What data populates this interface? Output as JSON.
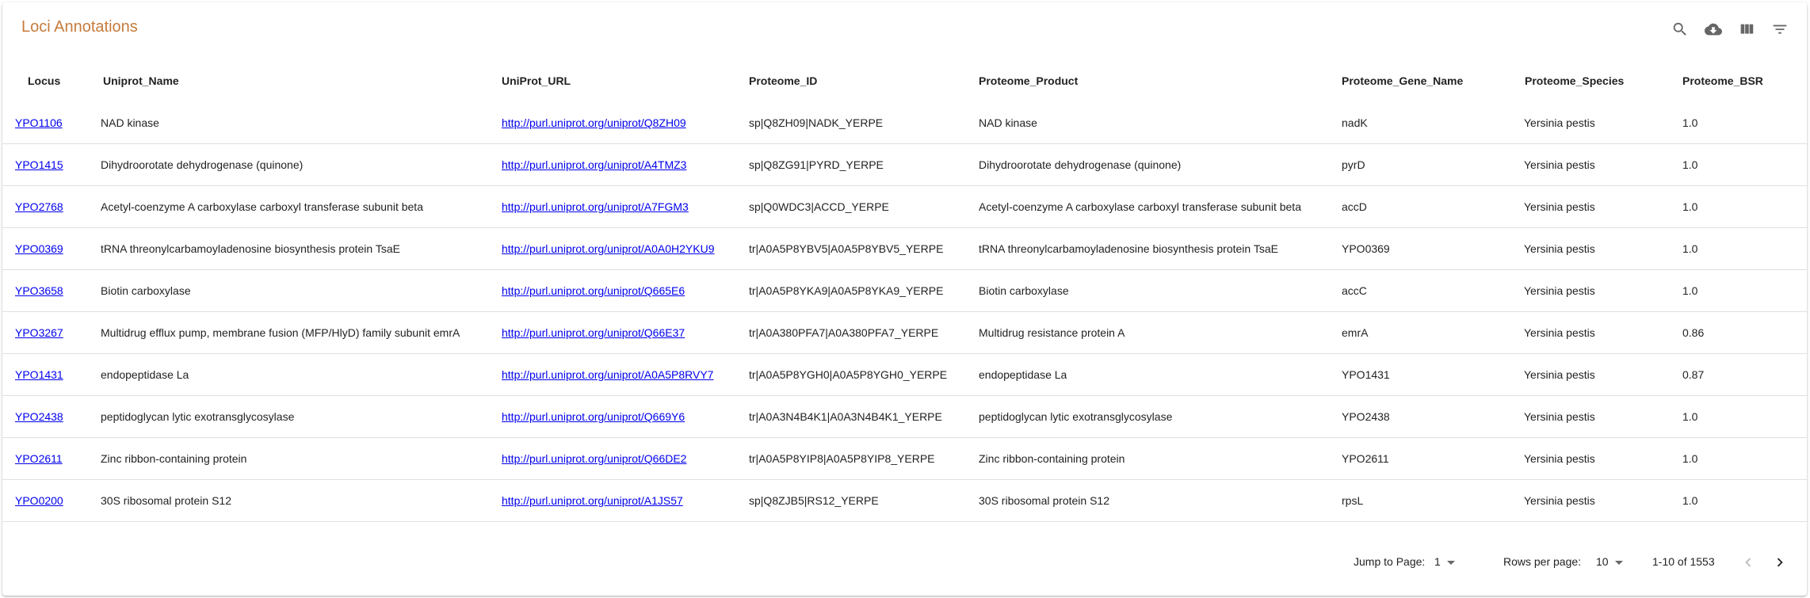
{
  "header": {
    "title": "Loci Annotations",
    "icons": [
      "search-icon",
      "cloud-download-icon",
      "view-columns-icon",
      "filter-icon"
    ]
  },
  "table": {
    "columns": [
      "Locus",
      "Uniprot_Name",
      "UniProt_URL",
      "Proteome_ID",
      "Proteome_Product",
      "Proteome_Gene_Name",
      "Proteome_Species",
      "Proteome_BSR"
    ],
    "rows": [
      [
        "YPO1106",
        "NAD kinase",
        "http://purl.uniprot.org/uniprot/Q8ZH09",
        "sp|Q8ZH09|NADK_YERPE",
        "NAD kinase",
        "nadK",
        "Yersinia pestis",
        "1.0"
      ],
      [
        "YPO1415",
        "Dihydroorotate dehydrogenase (quinone)",
        "http://purl.uniprot.org/uniprot/A4TMZ3",
        "sp|Q8ZG91|PYRD_YERPE",
        "Dihydroorotate dehydrogenase (quinone)",
        "pyrD",
        "Yersinia pestis",
        "1.0"
      ],
      [
        "YPO2768",
        "Acetyl-coenzyme A carboxylase carboxyl transferase subunit beta",
        "http://purl.uniprot.org/uniprot/A7FGM3",
        "sp|Q0WDC3|ACCD_YERPE",
        "Acetyl-coenzyme A carboxylase carboxyl transferase subunit beta",
        "accD",
        "Yersinia pestis",
        "1.0"
      ],
      [
        "YPO0369",
        "tRNA threonylcarbamoyladenosine biosynthesis protein TsaE",
        "http://purl.uniprot.org/uniprot/A0A0H2YKU9",
        "tr|A0A5P8YBV5|A0A5P8YBV5_YERPE",
        "tRNA threonylcarbamoyladenosine biosynthesis protein TsaE",
        "YPO0369",
        "Yersinia pestis",
        "1.0"
      ],
      [
        "YPO3658",
        "Biotin carboxylase",
        "http://purl.uniprot.org/uniprot/Q665E6",
        "tr|A0A5P8YKA9|A0A5P8YKA9_YERPE",
        "Biotin carboxylase",
        "accC",
        "Yersinia pestis",
        "1.0"
      ],
      [
        "YPO3267",
        "Multidrug efflux pump, membrane fusion (MFP/HlyD) family subunit emrA",
        "http://purl.uniprot.org/uniprot/Q66E37",
        "tr|A0A380PFA7|A0A380PFA7_YERPE",
        "Multidrug resistance protein A",
        "emrA",
        "Yersinia pestis",
        "0.86"
      ],
      [
        "YPO1431",
        "endopeptidase La",
        "http://purl.uniprot.org/uniprot/A0A5P8RVY7",
        "tr|A0A5P8YGH0|A0A5P8YGH0_YERPE",
        "endopeptidase La",
        "YPO1431",
        "Yersinia pestis",
        "0.87"
      ],
      [
        "YPO2438",
        "peptidoglycan lytic exotransglycosylase",
        "http://purl.uniprot.org/uniprot/Q669Y6",
        "tr|A0A3N4B4K1|A0A3N4B4K1_YERPE",
        "peptidoglycan lytic exotransglycosylase",
        "YPO2438",
        "Yersinia pestis",
        "1.0"
      ],
      [
        "YPO2611",
        "Zinc ribbon-containing protein",
        "http://purl.uniprot.org/uniprot/Q66DE2",
        "tr|A0A5P8YIP8|A0A5P8YIP8_YERPE",
        "Zinc ribbon-containing protein",
        "YPO2611",
        "Yersinia pestis",
        "1.0"
      ],
      [
        "YPO0200",
        "30S ribosomal protein S12",
        "http://purl.uniprot.org/uniprot/A1JS57",
        "sp|Q8ZJB5|RS12_YERPE",
        "30S ribosomal protein S12",
        "rpsL",
        "Yersinia pestis",
        "1.0"
      ]
    ]
  },
  "footer": {
    "jump_label": "Jump to Page:",
    "jump_value": "1",
    "rows_label": "Rows per page:",
    "rows_value": "10",
    "range": "1-10 of 1553"
  },
  "colors": {
    "title": "#c67b3c",
    "link": "#0000ee",
    "divider": "#e0e0e0"
  }
}
